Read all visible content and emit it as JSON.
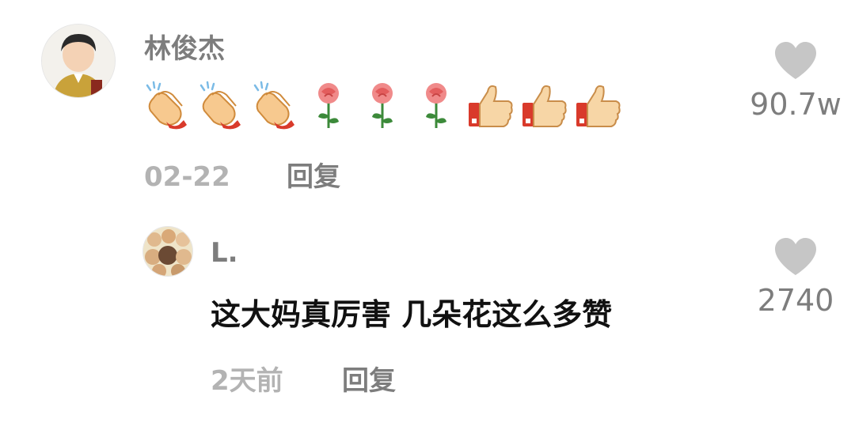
{
  "comments": [
    {
      "username": "林俊杰",
      "emojis": [
        "clapping-hands",
        "clapping-hands",
        "clapping-hands",
        "rose",
        "rose",
        "rose",
        "thumbs-up",
        "thumbs-up",
        "thumbs-up"
      ],
      "date": "02-22",
      "reply_label": "回复",
      "like_count": "90.7w",
      "icon": "heart-icon"
    },
    {
      "username": "L.",
      "text": "这大妈真厉害 几朵花这么多赞",
      "date": "2天前",
      "reply_label": "回复",
      "like_count": "2740",
      "icon": "heart-icon"
    }
  ],
  "colors": {
    "username": "#7d7d7d",
    "text": "#111111",
    "date": "#b3b3b3",
    "heart": "#c6c6c6"
  }
}
